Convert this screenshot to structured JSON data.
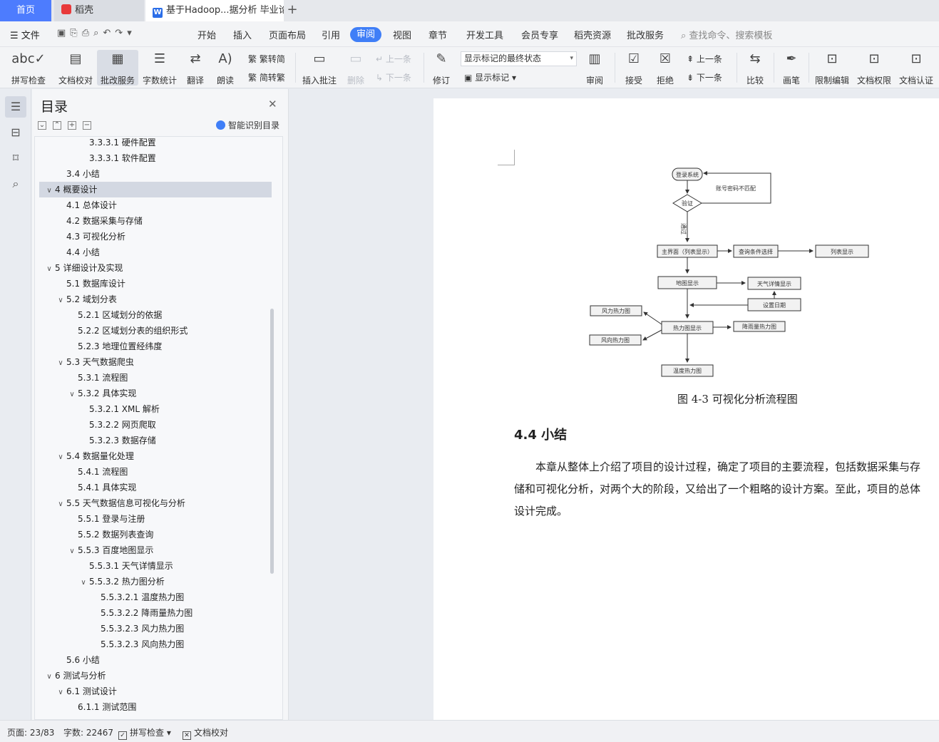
{
  "tabs": {
    "home": "首页",
    "docer": "稻壳",
    "doc": "基于Hadoop...据分析 毕业论文"
  },
  "menu": {
    "file": "文件",
    "items": [
      "开始",
      "插入",
      "页面布局",
      "引用"
    ],
    "active": "审阅",
    "items2": [
      "视图",
      "章节",
      "开发工具",
      "会员专享",
      "稻壳资源",
      "批改服务"
    ],
    "search": "查找命令、搜索模板"
  },
  "ribbon": {
    "spellcheck": "拼写检查",
    "proofread": "文档校对",
    "correction_service": "批改服务",
    "word_count": "字数统计",
    "translate": "翻译",
    "read_aloud": "朗读",
    "trad_to_simp": "繁转简",
    "simp_to_trad": "简转繁",
    "insert_comment": "插入批注",
    "delete": "删除",
    "prev_comment": "上一条",
    "next_comment": "下一条",
    "track_changes": "修订",
    "markup_state": "显示标记的最终状态",
    "show_markup": "显示标记",
    "review": "审阅",
    "accept": "接受",
    "reject": "拒绝",
    "prev_change": "上一条",
    "next_change": "下一条",
    "compare": "比较",
    "ink": "画笔",
    "restrict_edit": "限制编辑",
    "doc_permission": "文档权限",
    "doc_certify": "文档认证"
  },
  "toc": {
    "title": "目录",
    "smart": "智能识别目录",
    "items": [
      {
        "text": "3.3.3.1  硬件配置",
        "level": 4,
        "chev": ""
      },
      {
        "text": "3.3.3.1  软件配置",
        "level": 4,
        "chev": ""
      },
      {
        "text": "3.4  小结",
        "level": 2,
        "chev": ""
      },
      {
        "text": "4  概要设计",
        "level": 1,
        "chev": "v",
        "selected": true
      },
      {
        "text": "4.1  总体设计",
        "level": 2,
        "chev": ""
      },
      {
        "text": "4.2  数据采集与存储",
        "level": 2,
        "chev": ""
      },
      {
        "text": "4.3  可视化分析",
        "level": 2,
        "chev": ""
      },
      {
        "text": "4.4  小结",
        "level": 2,
        "chev": ""
      },
      {
        "text": "5  详细设计及实现",
        "level": 1,
        "chev": "v"
      },
      {
        "text": "5.1  数据库设计",
        "level": 2,
        "chev": ""
      },
      {
        "text": "5.2  域划分表",
        "level": 2,
        "chev": "v"
      },
      {
        "text": "5.2.1  区域划分的依据",
        "level": 3,
        "chev": ""
      },
      {
        "text": "5.2.2  区域划分表的组织形式",
        "level": 3,
        "chev": ""
      },
      {
        "text": "5.2.3  地理位置经纬度",
        "level": 3,
        "chev": ""
      },
      {
        "text": "5.3  天气数据爬虫",
        "level": 2,
        "chev": "v"
      },
      {
        "text": "5.3.1  流程图",
        "level": 3,
        "chev": ""
      },
      {
        "text": "5.3.2  具体实现",
        "level": 3,
        "chev": "v"
      },
      {
        "text": "5.3.2.1 XML 解析",
        "level": 4,
        "chev": ""
      },
      {
        "text": "5.3.2.2  网页爬取",
        "level": 4,
        "chev": ""
      },
      {
        "text": "5.3.2.3  数据存储",
        "level": 4,
        "chev": ""
      },
      {
        "text": "5.4  数据量化处理",
        "level": 2,
        "chev": "v"
      },
      {
        "text": "5.4.1  流程图",
        "level": 3,
        "chev": ""
      },
      {
        "text": "5.4.1 具体实现",
        "level": 3,
        "chev": ""
      },
      {
        "text": "5.5  天气数据信息可视化与分析",
        "level": 2,
        "chev": "v"
      },
      {
        "text": "5.5.1  登录与注册",
        "level": 3,
        "chev": ""
      },
      {
        "text": "5.5.2  数据列表查询",
        "level": 3,
        "chev": ""
      },
      {
        "text": "5.5.3  百度地图显示",
        "level": 3,
        "chev": "v"
      },
      {
        "text": "5.5.3.1  天气详情显示",
        "level": 4,
        "chev": ""
      },
      {
        "text": "5.5.3.2  热力图分析",
        "level": 4,
        "chev": "v"
      },
      {
        "text": "5.5.3.2.1  温度热力图",
        "level": 5,
        "chev": ""
      },
      {
        "text": "5.5.3.2.2  降雨量热力图",
        "level": 5,
        "chev": ""
      },
      {
        "text": "5.5.3.2.3  风力热力图",
        "level": 5,
        "chev": ""
      },
      {
        "text": "5.5.3.2.3  风向热力图",
        "level": 5,
        "chev": ""
      },
      {
        "text": "5.6 小结",
        "level": 2,
        "chev": ""
      },
      {
        "text": "6  测试与分析",
        "level": 1,
        "chev": "v"
      },
      {
        "text": "6.1  测试设计",
        "level": 2,
        "chev": "v"
      },
      {
        "text": "6.1.1  测试范围",
        "level": 3,
        "chev": ""
      }
    ]
  },
  "document": {
    "flowchart": {
      "login": "登录系统",
      "mismatch": "账号密码不匹配",
      "verify": "验证",
      "pass": "通过",
      "main": "主界面（列表显示）",
      "query": "查询条件选择",
      "list": "列表显示",
      "map": "地图显示",
      "weather_detail": "天气详情显示",
      "set_date": "设置日期",
      "wind_force": "风力热力图",
      "heatmap": "热力图显示",
      "rain": "降雨量热力图",
      "wind_dir": "风向热力图",
      "temp": "温度热力图"
    },
    "caption": "图 4-3  可视化分析流程图",
    "section": "4.4  小结",
    "para_lines": [
      "　　本章从整体上介绍了项目的设计过程，确定了项目的主要流程，包括数据采集与存",
      "储和可视化分析，对两个大的阶段，又给出了一个粗略的设计方案。至此，项目的总体",
      "设计完成。"
    ]
  },
  "status": {
    "page": "页面: 23/83",
    "words": "字数: 22467",
    "spellcheck": "拼写检查",
    "proofread": "文档校对"
  }
}
